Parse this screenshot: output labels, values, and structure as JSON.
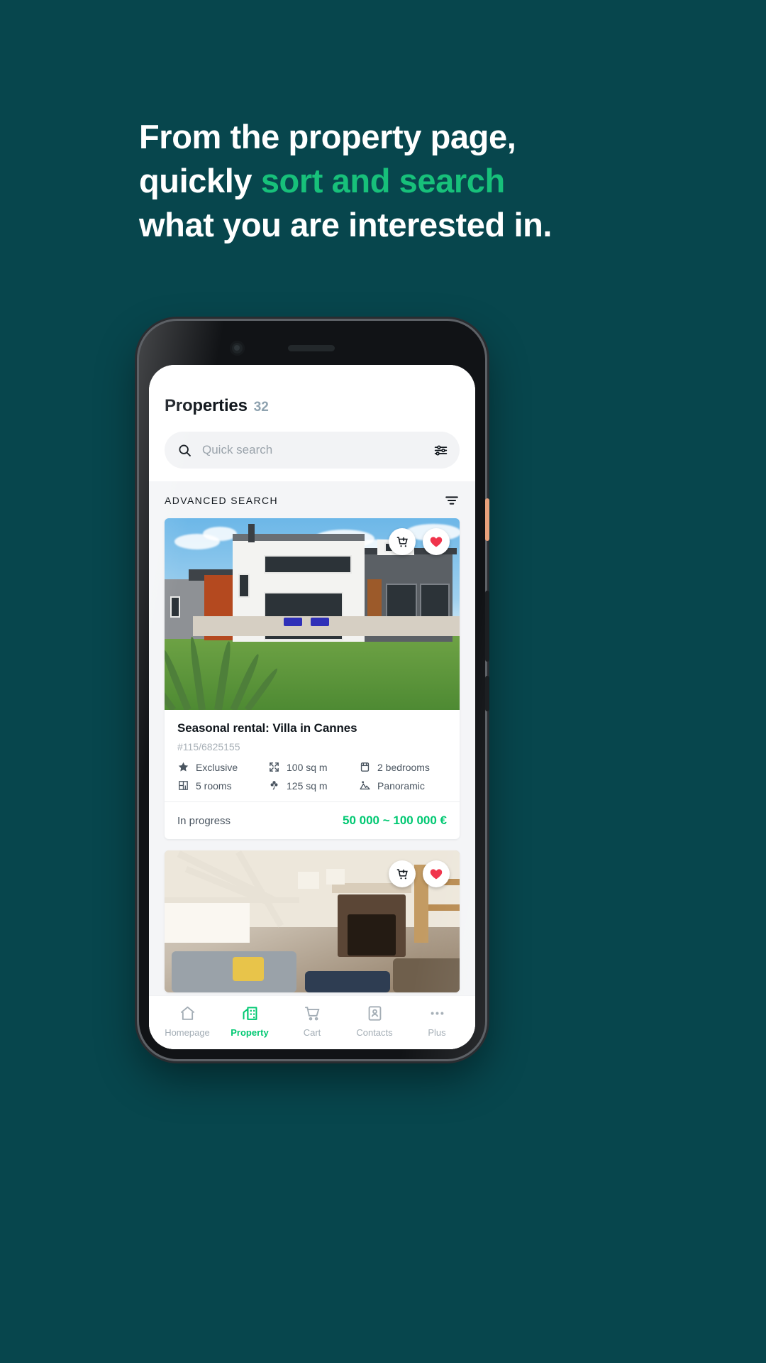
{
  "promo": {
    "line1_plain": "From the property page,",
    "line2_plain_start": "quickly ",
    "line2_accent": "sort and search",
    "line3_plain": "what you are interested in.",
    "accent_color": "#17C07A",
    "background_color": "#07464D"
  },
  "app": {
    "header": {
      "title": "Properties",
      "count": "32"
    },
    "search": {
      "placeholder": "Quick search",
      "value": "",
      "search_icon": "search-icon",
      "filter_icon": "sliders-icon"
    },
    "advanced_search": {
      "label": "ADVANCED SEARCH",
      "icon": "filter-lines-icon"
    },
    "cards": [
      {
        "title": "Seasonal rental: Villa in Cannes",
        "reference": "#115/6825155",
        "features": [
          {
            "icon": "star-icon",
            "label": "Exclusive"
          },
          {
            "icon": "expand-icon",
            "label": "100 sq m"
          },
          {
            "icon": "bed-icon",
            "label": "2 bedrooms"
          },
          {
            "icon": "floorplan-icon",
            "label": "5 rooms"
          },
          {
            "icon": "flower-icon",
            "label": "125 sq m"
          },
          {
            "icon": "mountain-icon",
            "label": "Panoramic"
          }
        ],
        "status": "In progress",
        "price": "50 000 ~ 100 000 €",
        "price_color": "#00C872",
        "actions": [
          {
            "icon": "add-to-cart-icon",
            "name": "add-to-cart-button"
          },
          {
            "icon": "heart-icon",
            "name": "favorite-button",
            "color": "#F0334B",
            "active": true
          }
        ]
      },
      {
        "title": "",
        "reference": "",
        "features": [],
        "status": "",
        "price": "",
        "actions": [
          {
            "icon": "add-to-cart-icon",
            "name": "add-to-cart-button"
          },
          {
            "icon": "heart-icon",
            "name": "favorite-button",
            "color": "#F0334B",
            "active": true
          }
        ]
      }
    ],
    "bottom_nav": [
      {
        "label": "Homepage",
        "icon": "home-icon",
        "active": false
      },
      {
        "label": "Property",
        "icon": "building-icon",
        "active": true
      },
      {
        "label": "Cart",
        "icon": "cart-icon",
        "active": false
      },
      {
        "label": "Contacts",
        "icon": "contacts-icon",
        "active": false
      },
      {
        "label": "Plus",
        "icon": "ellipsis-icon",
        "active": false
      }
    ],
    "active_nav_color": "#00C872"
  }
}
